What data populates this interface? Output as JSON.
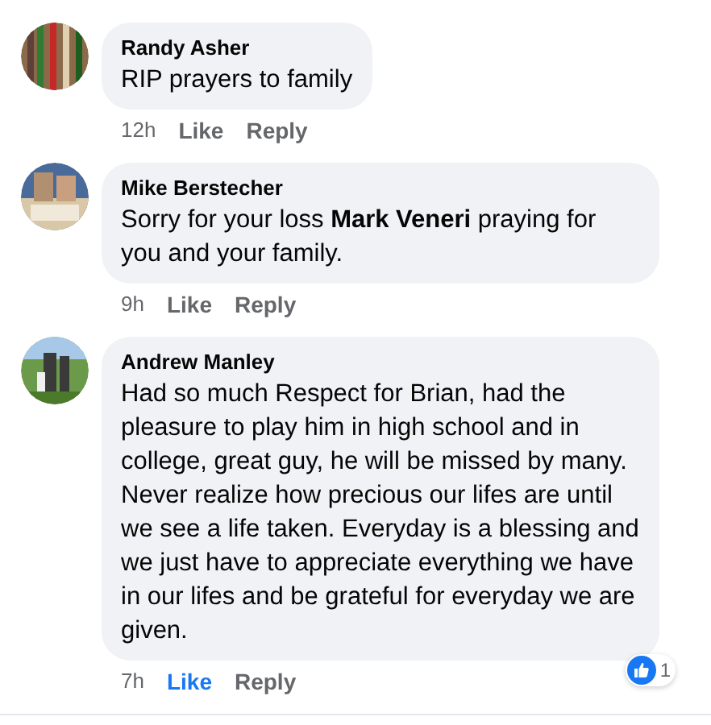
{
  "comments": [
    {
      "author": "Randy Asher",
      "text": "RIP prayers to family",
      "time": "12h",
      "like": "Like",
      "liked": false,
      "reply": "Reply"
    },
    {
      "author": "Mike Berstecher",
      "text": "Sorry for your loss **Mark Veneri** praying for you and your family.",
      "time": "9h",
      "like": "Like",
      "liked": false,
      "reply": "Reply"
    },
    {
      "author": "Andrew Manley",
      "text": "Had so much Respect for Brian, had the pleasure to play him in high school and in college, great guy, he will be missed by many. Never realize how precious our lifes are until we see a life taken. Everyday is a blessing and we just have to appreciate everything we have in our lifes and be grateful for everyday we are given.",
      "time": "7h",
      "like": "Like",
      "liked": true,
      "reply": "Reply",
      "reactions": "1"
    }
  ]
}
